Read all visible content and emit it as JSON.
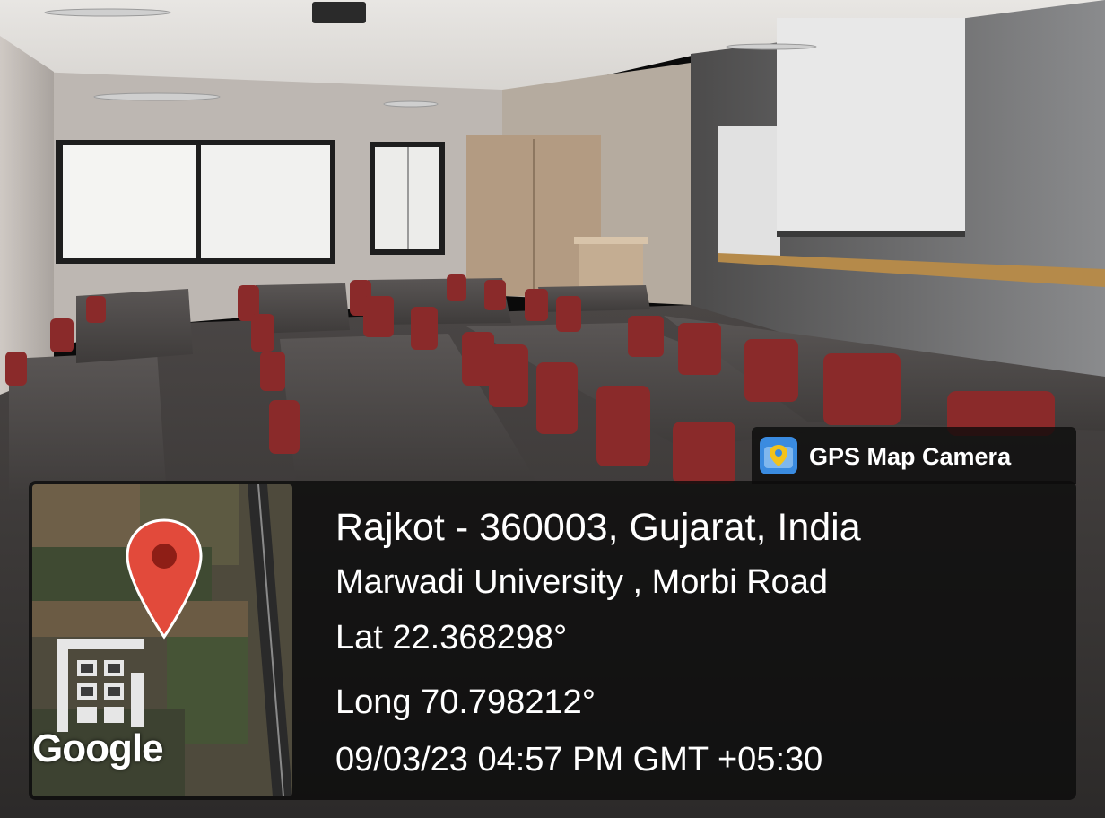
{
  "badge": {
    "label": "GPS Map Camera",
    "icon": "gps-camera-icon"
  },
  "map": {
    "brand": "Google",
    "pin_icon": "map-pin-icon",
    "pin_color": "#e24a3b"
  },
  "location": {
    "address": "Rajkot - 360003, Gujarat, India",
    "street": "Marwadi University , Morbi Road",
    "latitude": "Lat 22.368298°",
    "longitude": "Long 70.798212°",
    "timestamp": "09/03/23 04:57 PM GMT +05:30"
  },
  "colors": {
    "overlay": "#0c0c0c",
    "text": "#ffffff",
    "chairs": "#8a2a2a"
  }
}
